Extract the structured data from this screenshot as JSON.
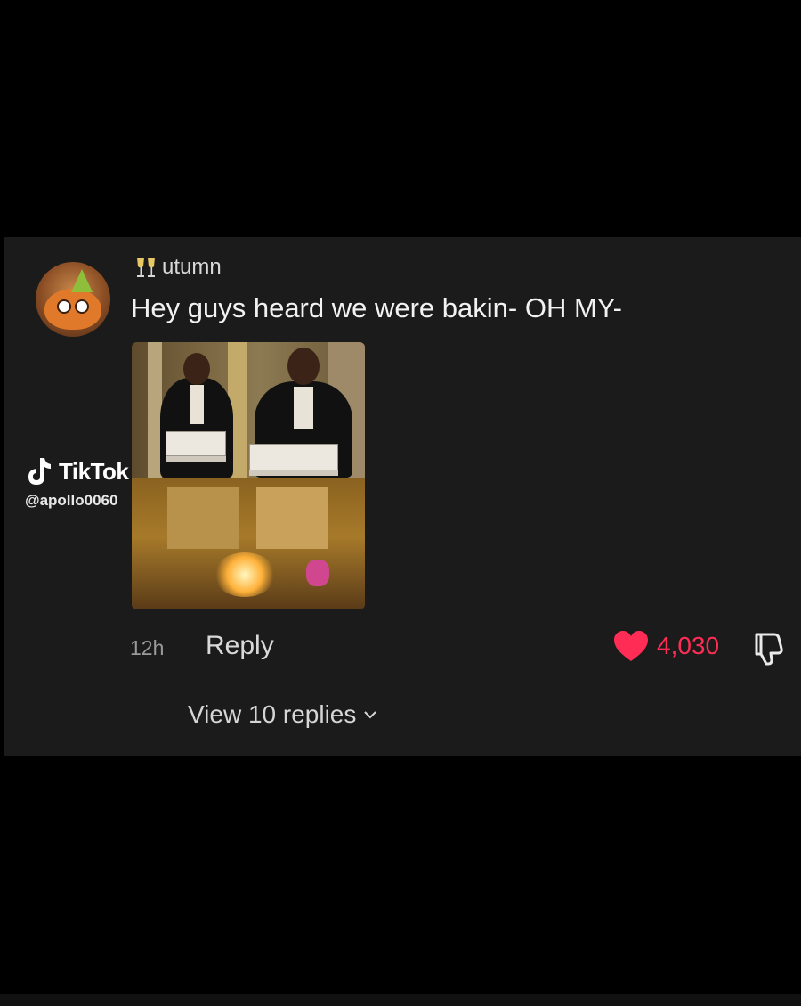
{
  "comment": {
    "username": "utumn",
    "username_prefix_icon": "champagne-glasses-icon",
    "text": "Hey guys heard we were bakin- OH MY-",
    "timestamp": "12h",
    "reply_label": "Reply",
    "like_count": "4,030",
    "liked": true,
    "view_replies_label": "View 10 replies"
  },
  "watermark": {
    "brand": "TikTok",
    "handle": "@apollo0060"
  },
  "colors": {
    "background": "#000000",
    "card_background": "#1b1b1b",
    "like_red": "#ff2d55",
    "text_primary": "#f2f2f2",
    "text_secondary": "#9a9a9a"
  }
}
